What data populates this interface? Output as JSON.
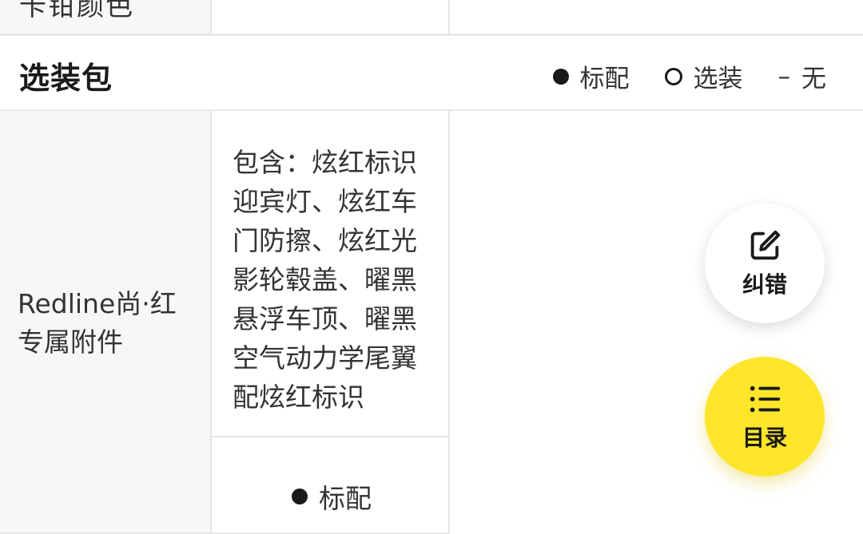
{
  "top_row": {
    "cut_label": "卡钳颜色"
  },
  "section": {
    "title": "选装包",
    "legend": {
      "standard": "标配",
      "optional": "选装",
      "none_mark": "–",
      "none": "无"
    }
  },
  "row": {
    "label": "Redline尚·红专属附件",
    "description": "包含：炫红标识迎宾灯、炫红车门防擦、炫红光影轮毂盖、曜黑悬浮车顶、曜黑空气动力学尾翼配炫红标识",
    "value": "标配"
  },
  "fab": {
    "feedback_label": "纠错",
    "feedback_icon": "edit-icon",
    "toc_label": "目录",
    "toc_icon": "list-icon"
  },
  "colors": {
    "accent_yellow": "#fde62a",
    "label_bg": "#f7f7f7",
    "border": "#e6e6e6"
  }
}
